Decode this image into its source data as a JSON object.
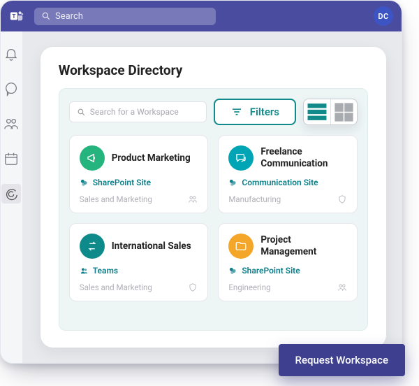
{
  "header": {
    "search_placeholder": "Search",
    "avatar_initials": "DC"
  },
  "sidebar": {
    "items": [
      {
        "name": "activity",
        "icon": "bell-icon"
      },
      {
        "name": "chat",
        "icon": "chat-icon"
      },
      {
        "name": "teams",
        "icon": "people-icon"
      },
      {
        "name": "calendar",
        "icon": "calendar-icon"
      },
      {
        "name": "orchestry",
        "icon": "swirl-icon",
        "active": true
      }
    ]
  },
  "panel": {
    "title": "Workspace Directory",
    "workspace_search_placeholder": "Search for a Workspace",
    "filters_label": "Filters"
  },
  "workspaces": [
    {
      "title": "Product Marketing",
      "badge_color": "green",
      "badge_icon": "megaphone-icon",
      "site_type": "SharePoint Site",
      "site_icon": "sharepoint-icon",
      "category": "Sales and Marketing",
      "meta_icon": "people-icon"
    },
    {
      "title": "Freelance Communication",
      "badge_color": "teal",
      "badge_icon": "speech-icon",
      "site_type": "Communication Site",
      "site_icon": "sharepoint-icon",
      "category": "Manufacturing",
      "meta_icon": "shield-icon"
    },
    {
      "title": "International Sales",
      "badge_color": "tealdk",
      "badge_icon": "exchange-icon",
      "site_type": "Teams",
      "site_icon": "teams-icon",
      "category": "Sales and Marketing",
      "meta_icon": "shield-icon"
    },
    {
      "title": "Project Management",
      "badge_color": "orange",
      "badge_icon": "folder-icon",
      "site_type": "SharePoint Site",
      "site_icon": "sharepoint-icon",
      "category": "Engineering",
      "meta_icon": "people-icon"
    }
  ],
  "cta": {
    "label": "Request Workspace"
  },
  "colors": {
    "primary_purple": "#4a4ca0",
    "accent_teal": "#118a8a"
  }
}
